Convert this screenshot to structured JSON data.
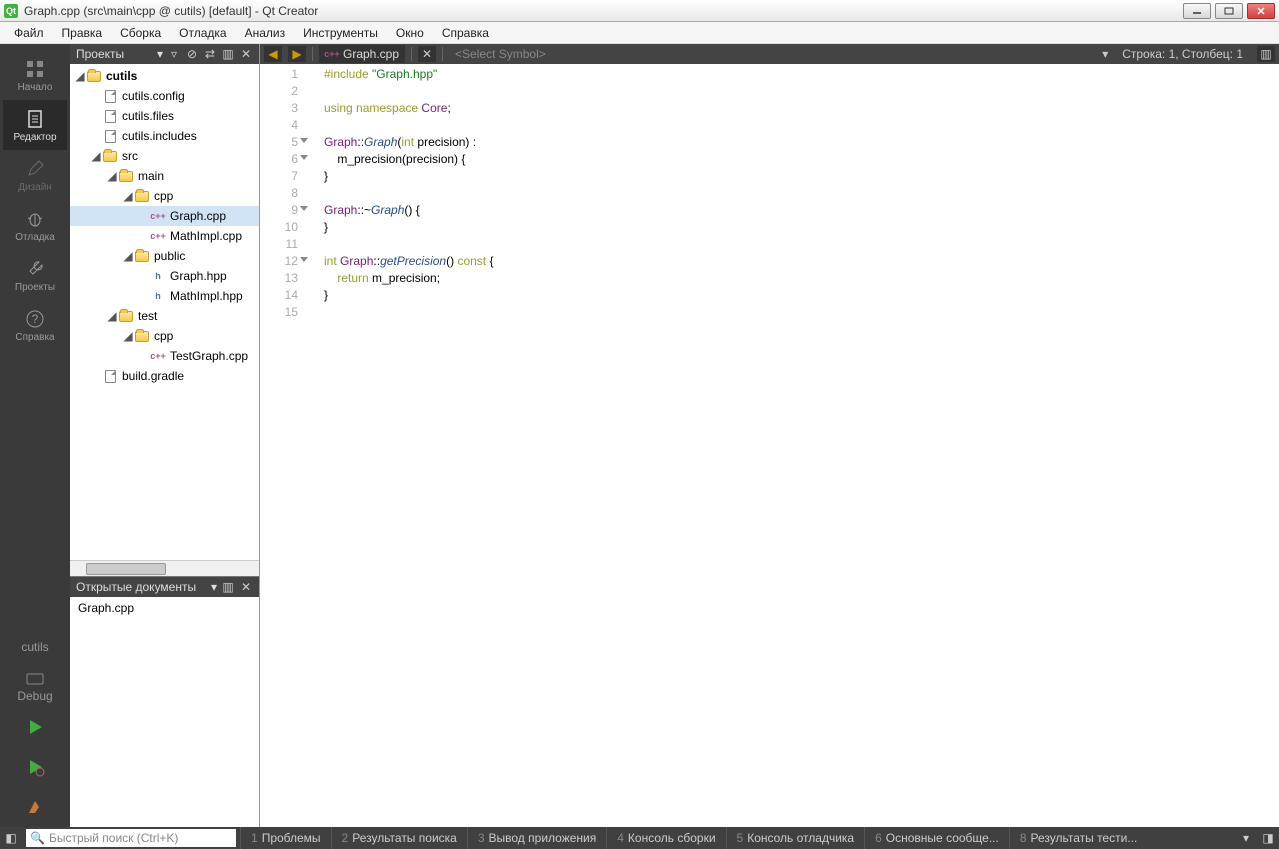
{
  "title": "Graph.cpp (src\\main\\cpp @ cutils) [default] - Qt Creator",
  "menu": [
    "Файл",
    "Правка",
    "Сборка",
    "Отладка",
    "Анализ",
    "Инструменты",
    "Окно",
    "Справка"
  ],
  "sidebar": [
    {
      "id": "welcome",
      "label": "Начало",
      "icon": "grid"
    },
    {
      "id": "edit",
      "label": "Редактор",
      "icon": "doc",
      "active": true
    },
    {
      "id": "design",
      "label": "Дизайн",
      "icon": "pencil",
      "dim": true
    },
    {
      "id": "debug",
      "label": "Отладка",
      "icon": "bug"
    },
    {
      "id": "projects",
      "label": "Проекты",
      "icon": "wrench"
    },
    {
      "id": "help",
      "label": "Справка",
      "icon": "question"
    }
  ],
  "sidebar_bottom": {
    "project": "cutils",
    "config": "Debug"
  },
  "projects_panel": {
    "title": "Проекты"
  },
  "tree": [
    {
      "d": 0,
      "exp": true,
      "icon": "folder",
      "name": "cutils",
      "bold": true
    },
    {
      "d": 1,
      "icon": "file",
      "name": "cutils.config"
    },
    {
      "d": 1,
      "icon": "file",
      "name": "cutils.files"
    },
    {
      "d": 1,
      "icon": "file",
      "name": "cutils.includes"
    },
    {
      "d": 1,
      "exp": true,
      "icon": "folder",
      "name": "src"
    },
    {
      "d": 2,
      "exp": true,
      "icon": "folder",
      "name": "main"
    },
    {
      "d": 3,
      "exp": true,
      "icon": "folder",
      "name": "cpp"
    },
    {
      "d": 4,
      "icon": "cpp",
      "name": "Graph.cpp",
      "sel": true
    },
    {
      "d": 4,
      "icon": "cpp",
      "name": "MathImpl.cpp"
    },
    {
      "d": 3,
      "exp": true,
      "icon": "folder",
      "name": "public"
    },
    {
      "d": 4,
      "icon": "hpp",
      "name": "Graph.hpp"
    },
    {
      "d": 4,
      "icon": "hpp",
      "name": "MathImpl.hpp"
    },
    {
      "d": 2,
      "exp": true,
      "icon": "folder",
      "name": "test"
    },
    {
      "d": 3,
      "exp": true,
      "icon": "folder",
      "name": "cpp"
    },
    {
      "d": 4,
      "icon": "cpp",
      "name": "TestGraph.cpp"
    },
    {
      "d": 1,
      "icon": "file",
      "name": "build.gradle"
    }
  ],
  "opendocs": {
    "title": "Открытые документы",
    "items": [
      "Graph.cpp"
    ]
  },
  "editor": {
    "file": "Graph.cpp",
    "symbol_placeholder": "<Select Symbol>",
    "status": "Строка: 1, Столбец: 1",
    "lines": [
      {
        "n": 1,
        "html": "<span class='kw'>#include</span> <span class='str'>\"Graph.hpp\"</span>"
      },
      {
        "n": 2,
        "html": ""
      },
      {
        "n": 3,
        "html": "<span class='kw'>using</span> <span class='kw'>namespace</span> <span class='type'>Core</span>;"
      },
      {
        "n": 4,
        "html": ""
      },
      {
        "n": 5,
        "fold": true,
        "html": "<span class='type'>Graph</span>::<span class='fn'>Graph</span>(<span class='kw'>int</span> precision) :"
      },
      {
        "n": 6,
        "fold": true,
        "html": "    m_precision(precision) {"
      },
      {
        "n": 7,
        "html": "}"
      },
      {
        "n": 8,
        "html": ""
      },
      {
        "n": 9,
        "fold": true,
        "html": "<span class='type'>Graph</span>::~<span class='fn'>Graph</span>() {"
      },
      {
        "n": 10,
        "html": "}"
      },
      {
        "n": 11,
        "html": ""
      },
      {
        "n": 12,
        "fold": true,
        "html": "<span class='kw'>int</span> <span class='type'>Graph</span>::<span class='fn'>getPrecision</span>() <span class='kw'>const</span> {"
      },
      {
        "n": 13,
        "html": "    <span class='kw'>return</span> m_precision;"
      },
      {
        "n": 14,
        "html": "}"
      },
      {
        "n": 15,
        "html": ""
      }
    ]
  },
  "statusbar": {
    "search_placeholder": "Быстрый поиск (Ctrl+K)",
    "panes": [
      {
        "n": "1",
        "t": "Проблемы"
      },
      {
        "n": "2",
        "t": "Результаты поиска"
      },
      {
        "n": "3",
        "t": "Вывод приложения"
      },
      {
        "n": "4",
        "t": "Консоль сборки"
      },
      {
        "n": "5",
        "t": "Консоль отладчика"
      },
      {
        "n": "6",
        "t": "Основные сообще..."
      },
      {
        "n": "8",
        "t": "Результаты тести..."
      }
    ]
  }
}
